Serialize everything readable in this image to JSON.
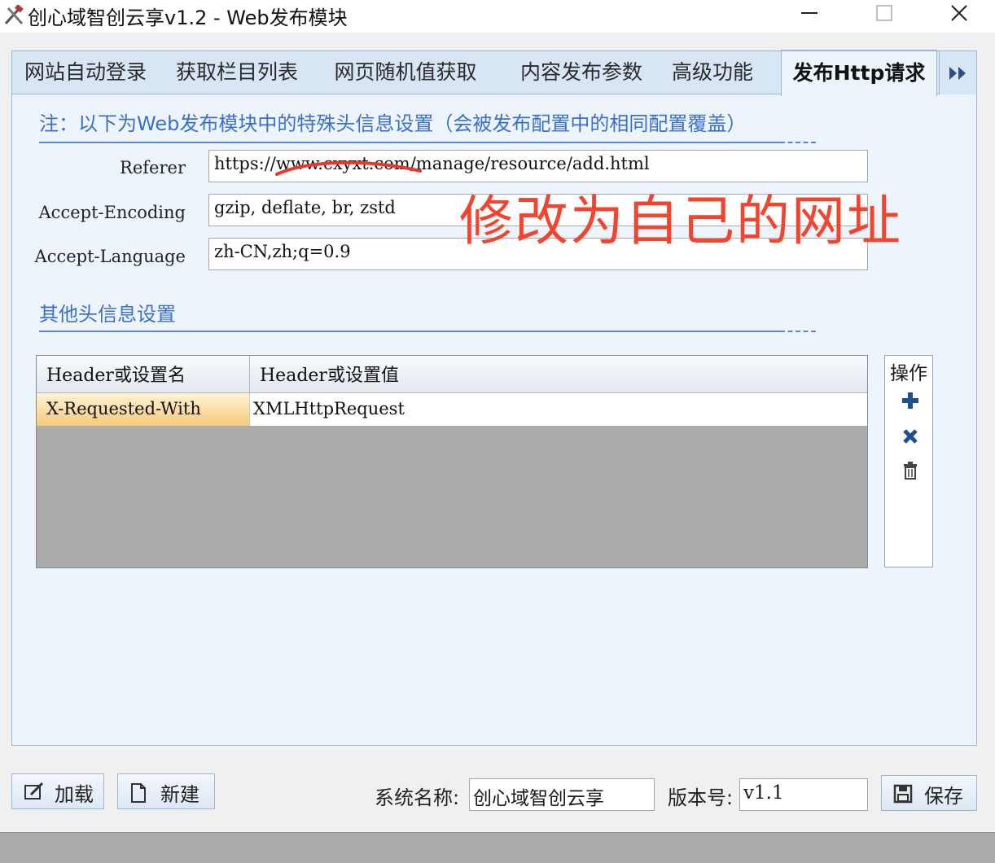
{
  "window": {
    "title": "创心域智创云享v1.2 - Web发布模块",
    "icon": "crossed-tools-icon",
    "controls": [
      "minimize-icon",
      "maximize-icon",
      "close-icon"
    ]
  },
  "tabs": [
    {
      "label": "网站自动登录",
      "active": false
    },
    {
      "label": "获取栏目列表",
      "active": false
    },
    {
      "label": "网页随机值获取",
      "active": false
    },
    {
      "label": "内容发布参数",
      "active": false
    },
    {
      "label": "高级功能",
      "active": false
    },
    {
      "label": "发布Http请求",
      "active": true
    }
  ],
  "note": "注：以下为Web发布模块中的特殊头信息设置（会被发布配置中的相同配置覆盖）",
  "fields": [
    {
      "label": "Referer",
      "value": "https://www.cxyxt.com/manage/resource/add.html"
    },
    {
      "label": "Accept-Encoding",
      "value": "gzip, deflate, br, zstd"
    },
    {
      "label": "Accept-Language",
      "value": "zh-CN,zh;q=0.9"
    }
  ],
  "other_headers": {
    "title": "其他头信息设置",
    "columns": [
      "Header或设置名",
      "Header或设置值"
    ],
    "rows": [
      {
        "name": "X-Requested-With",
        "value": "XMLHttpRequest"
      }
    ]
  },
  "ops": {
    "title": "操作",
    "buttons": [
      "plus-icon",
      "x-icon",
      "trash-icon"
    ]
  },
  "annotation": "修改为自己的网址",
  "bottom": {
    "load_label": "加载",
    "new_label": "新建",
    "system_name_label": "系统名称:",
    "system_name_value": "创心域智创云享",
    "version_label": "版本号:",
    "version_value": "v1.1",
    "save_label": "保存"
  },
  "colors": {
    "accent_blue": "#3a70c8",
    "annotation_red": "#f2442e",
    "selected_row": "#f7c978"
  }
}
